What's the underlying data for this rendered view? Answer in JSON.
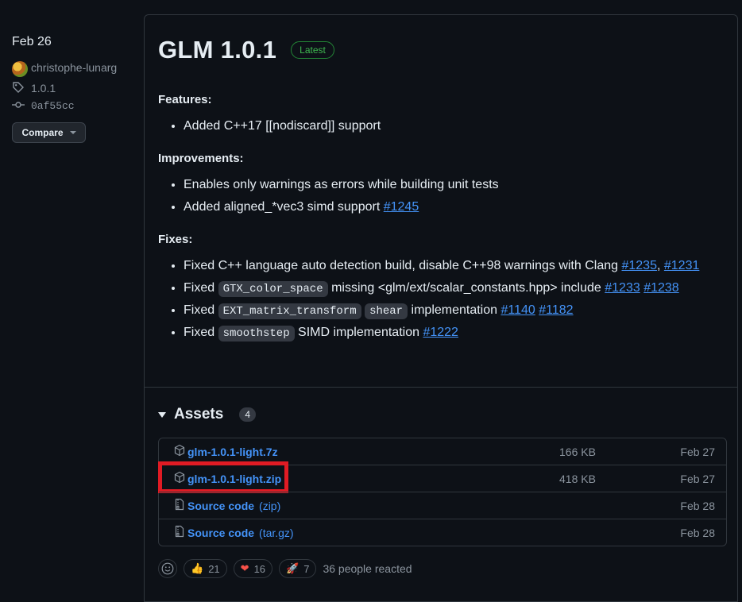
{
  "sidebar": {
    "date": "Feb 26",
    "author": "christophe-lunarg",
    "tag": "1.0.1",
    "commit": "0af55cc",
    "compare_label": "Compare"
  },
  "release": {
    "title": "GLM 1.0.1",
    "badge": "Latest",
    "features_heading": "Features:",
    "features": [
      "Added C++17 [[nodiscard]] support"
    ],
    "improvements_heading": "Improvements:",
    "improvement1": "Enables only warnings as errors while building unit tests",
    "improvement2_text": "Added aligned_*vec3 simd support",
    "improvement2_link": "#1245",
    "fixes_heading": "Fixes:",
    "fix1_text": "Fixed C++ language auto detection build, disable C++98 warnings with Clang",
    "fix1_link1": "#1235",
    "fix1_link2": "#1231",
    "fix2_pre": "Fixed",
    "fix2_code": "GTX_color_space",
    "fix2_post": "missing <glm/ext/scalar_constants.hpp> include",
    "fix2_link1": "#1233",
    "fix2_link2": "#1238",
    "fix3_pre": "Fixed",
    "fix3_code1": "EXT_matrix_transform",
    "fix3_code2": "shear",
    "fix3_post": "implementation",
    "fix3_link1": "#1140",
    "fix3_link2": "#1182",
    "fix4_pre": "Fixed",
    "fix4_code": "smoothstep",
    "fix4_post": "SIMD implementation",
    "fix4_link": "#1222"
  },
  "assets": {
    "title": "Assets",
    "count": "4",
    "rows": [
      {
        "name": "glm-1.0.1-light.7z",
        "ext": "",
        "size": "166 KB",
        "date": "Feb 27"
      },
      {
        "name": "glm-1.0.1-light.zip",
        "ext": "",
        "size": "418 KB",
        "date": "Feb 27"
      },
      {
        "name": "Source code",
        "ext": "(zip)",
        "size": "",
        "date": "Feb 28"
      },
      {
        "name": "Source code",
        "ext": "(tar.gz)",
        "size": "",
        "date": "Feb 28"
      }
    ]
  },
  "reactions": {
    "thumbs_up": "21",
    "heart": "16",
    "rocket": "7",
    "summary": "36 people reacted"
  },
  "colors": {
    "background": "#0d1117",
    "link": "#4493f8",
    "latest_badge": "#3fb950",
    "highlight": "#e01b24"
  }
}
